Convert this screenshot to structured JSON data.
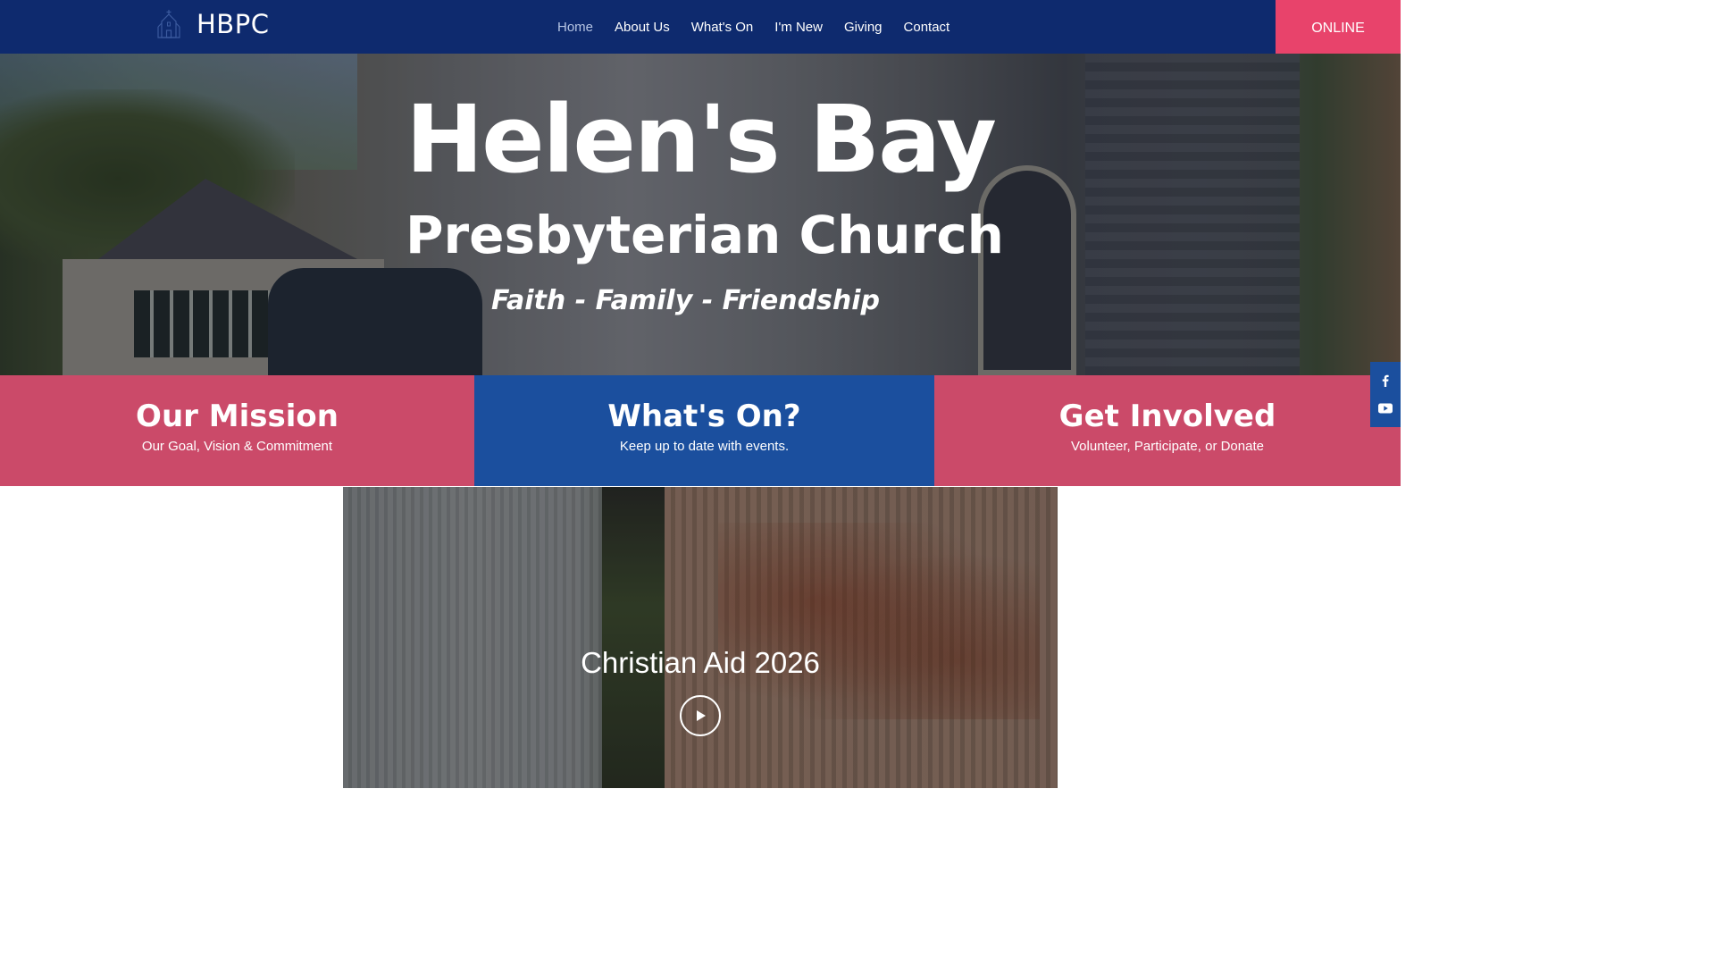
{
  "header": {
    "logo_text": "HBPC",
    "nav": [
      {
        "label": "Home",
        "active": true
      },
      {
        "label": "About Us",
        "active": false
      },
      {
        "label": "What's On",
        "active": false
      },
      {
        "label": "I'm New",
        "active": false
      },
      {
        "label": "Giving",
        "active": false
      },
      {
        "label": "Contact",
        "active": false
      }
    ],
    "online_label": "ONLINE"
  },
  "hero": {
    "title": "Helen's Bay",
    "subtitle": "Presbyterian Church",
    "tagline": "Faith - Family - Friendship"
  },
  "panels": [
    {
      "title": "Our Mission",
      "subtitle": "Our Goal, Vision & Commitment"
    },
    {
      "title": "What's On?",
      "subtitle": "Keep up to date with events."
    },
    {
      "title": "Get Involved",
      "subtitle": "Volunteer, Participate, or Donate"
    }
  ],
  "social": [
    {
      "icon": "facebook-icon"
    },
    {
      "icon": "youtube-icon"
    }
  ],
  "video": {
    "title": "Christian Aid 2026"
  },
  "colors": {
    "header_bg": "#0e2a6e",
    "online_bg": "#e8436b",
    "panel_pink": "#cb4a69",
    "panel_blue": "#1b4f9e",
    "nav_active": "#b5c4e3"
  }
}
